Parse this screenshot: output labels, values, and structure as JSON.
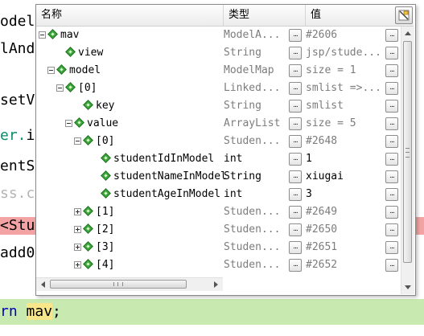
{
  "editor": {
    "lines": [
      {
        "id": "l1",
        "parts": [
          {
            "t": "odel",
            "c": ""
          }
        ]
      },
      {
        "id": "l2",
        "parts": [
          {
            "t": "lAnd",
            "c": ""
          }
        ]
      },
      {
        "id": "l3",
        "parts": [
          {
            "t": "setV",
            "c": ""
          }
        ]
      },
      {
        "id": "l4",
        "parts": [
          {
            "t": "er.",
            "c": "kw-green"
          },
          {
            "t": "i",
            "c": ""
          }
        ]
      },
      {
        "id": "l5",
        "parts": [
          {
            "t": "entS",
            "c": ""
          }
        ]
      },
      {
        "id": "l6",
        "parts": [
          {
            "t": "ss.c",
            "c": "dim"
          }
        ]
      },
      {
        "id": "l7",
        "parts": [
          {
            "t": "<Stu",
            "c": ""
          }
        ]
      },
      {
        "id": "l8",
        "parts": [
          {
            "t": "add0",
            "c": ""
          }
        ]
      },
      {
        "id": "l9",
        "parts": [
          {
            "t": "rn ",
            "c": "kw-blue"
          },
          {
            "t": "mav",
            "c": "mav-hl"
          },
          {
            "t": ";",
            "c": ""
          }
        ]
      }
    ]
  },
  "tooltip": {
    "headers": {
      "name": "名称",
      "type": "类型",
      "value": "值"
    },
    "ellipsis": "...",
    "rows": [
      {
        "name": "mav",
        "type": "ModelA...",
        "value": "#2606",
        "level": 0,
        "expander": "minus"
      },
      {
        "name": "view",
        "type": "String",
        "value": "jsp/stude...",
        "level": 1,
        "expander": "none"
      },
      {
        "name": "model",
        "type": "ModelMap",
        "value": "size = 1",
        "level": 1,
        "expander": "minus"
      },
      {
        "name": "[0]",
        "type": "Linked...",
        "value": "smlist =>...",
        "level": 2,
        "expander": "minus"
      },
      {
        "name": "key",
        "type": "String",
        "value": "smlist",
        "level": 3,
        "expander": "none"
      },
      {
        "name": "value",
        "type": "ArrayList",
        "value": "size = 5",
        "level": 3,
        "expander": "minus"
      },
      {
        "name": "[0]",
        "type": "Studen...",
        "value": "#2648",
        "level": 4,
        "expander": "minus"
      },
      {
        "name": "studentIdInModel",
        "type": "int",
        "value": "1",
        "level": 5,
        "expander": "none",
        "dark": true
      },
      {
        "name": "studentNameInModel",
        "type": "String",
        "value": "xiugai",
        "level": 5,
        "expander": "none",
        "dark": true
      },
      {
        "name": "studentAgeInModel",
        "type": "int",
        "value": "3",
        "level": 5,
        "expander": "none",
        "dark": true
      },
      {
        "name": "[1]",
        "type": "Studen...",
        "value": "#2649",
        "level": 4,
        "expander": "plus"
      },
      {
        "name": "[2]",
        "type": "Studen...",
        "value": "#2650",
        "level": 4,
        "expander": "plus"
      },
      {
        "name": "[3]",
        "type": "Studen...",
        "value": "#2651",
        "level": 4,
        "expander": "plus"
      },
      {
        "name": "[4]",
        "type": "Studen...",
        "value": "#2652",
        "level": 4,
        "expander": "plus"
      }
    ]
  },
  "icons": {
    "node": "variable-diamond-icon",
    "collapse": "collapse-minus-icon",
    "expand": "expand-plus-icon",
    "pin": "pin-icon"
  }
}
